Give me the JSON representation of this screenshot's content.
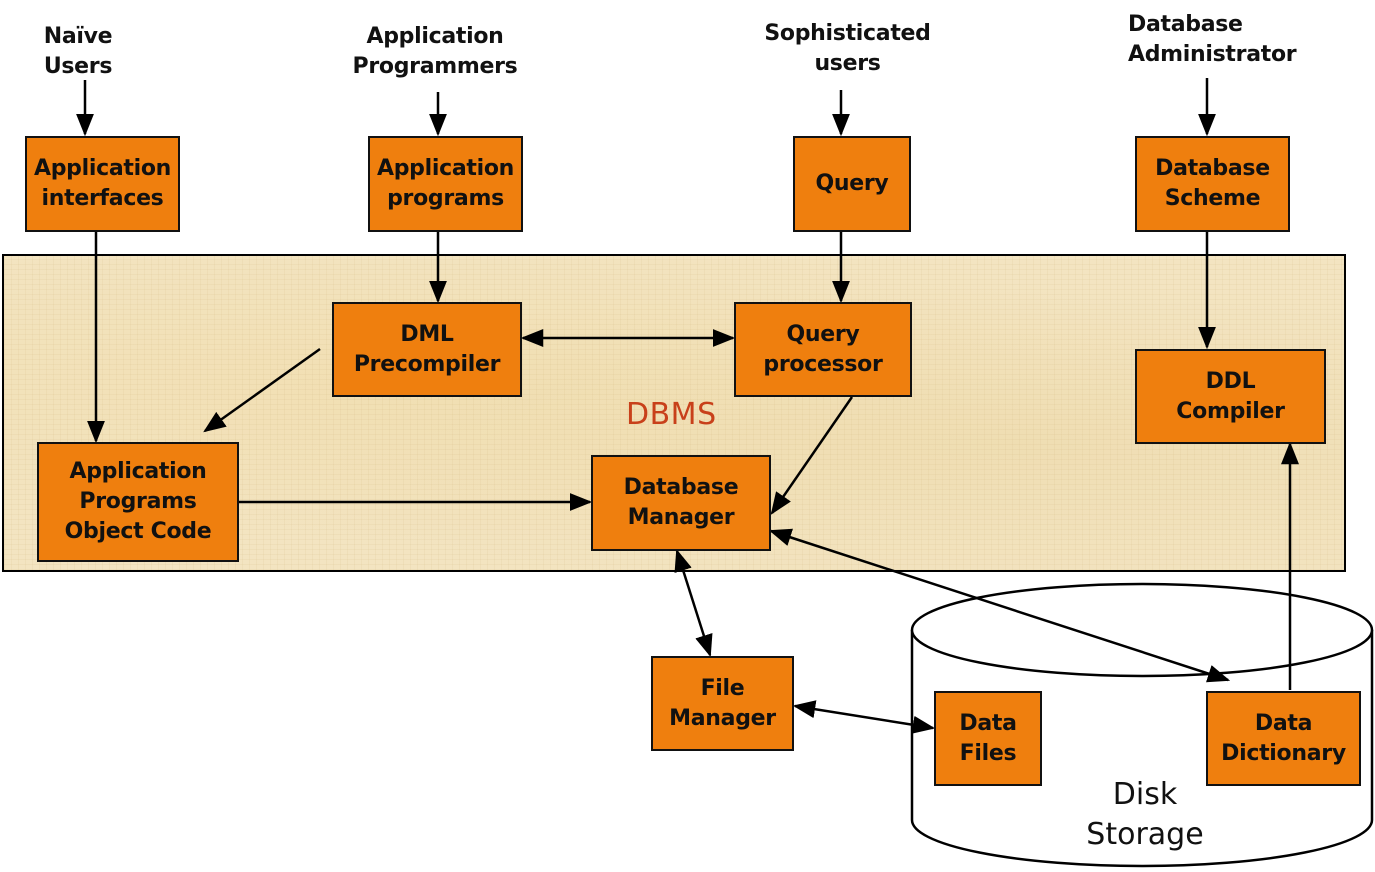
{
  "diagram": {
    "container_label": "DBMS",
    "actors": {
      "naive_users": "Naïve\nUsers",
      "application_programmers": "Application\nProgrammers",
      "sophisticated_users": "Sophisticated\nusers",
      "database_administrator": "Database\nAdministrator"
    },
    "boxes": {
      "application_interfaces": "Application\ninterfaces",
      "application_programs": "Application\nprograms",
      "query": "Query",
      "database_scheme": "Database\nScheme",
      "dml_precompiler": "DML\nPrecompiler",
      "query_processor": "Query\nprocessor",
      "ddl_compiler": "DDL\nCompiler",
      "application_programs_object_code": "Application\nPrograms\nObject Code",
      "database_manager": "Database\nManager",
      "file_manager": "File\nManager",
      "data_files": "Data\nFiles",
      "data_dictionary": "Data\nDictionary"
    },
    "storage_label": "Disk\nStorage",
    "edges": [
      {
        "from": "Naïve Users",
        "to": "Application interfaces",
        "direction": "forward"
      },
      {
        "from": "Application Programmers",
        "to": "Application programs",
        "direction": "forward"
      },
      {
        "from": "Sophisticated users",
        "to": "Query",
        "direction": "forward"
      },
      {
        "from": "Database Administrator",
        "to": "Database Scheme",
        "direction": "forward"
      },
      {
        "from": "Application interfaces",
        "to": "Application Programs Object Code",
        "direction": "forward"
      },
      {
        "from": "Application programs",
        "to": "DML Precompiler",
        "direction": "forward"
      },
      {
        "from": "Query",
        "to": "Query processor",
        "direction": "forward"
      },
      {
        "from": "Database Scheme",
        "to": "DDL Compiler",
        "direction": "forward"
      },
      {
        "from": "DML Precompiler",
        "to": "Query processor",
        "direction": "both"
      },
      {
        "from": "DML Precompiler",
        "to": "Application Programs Object Code",
        "direction": "forward"
      },
      {
        "from": "Application Programs Object Code",
        "to": "Database Manager",
        "direction": "forward"
      },
      {
        "from": "Query processor",
        "to": "Database Manager",
        "direction": "forward"
      },
      {
        "from": "Database Manager",
        "to": "File Manager",
        "direction": "both"
      },
      {
        "from": "Database Manager",
        "to": "Data Dictionary",
        "direction": "both"
      },
      {
        "from": "File Manager",
        "to": "Data Files",
        "direction": "both"
      },
      {
        "from": "Data Dictionary",
        "to": "DDL Compiler",
        "direction": "forward"
      }
    ]
  }
}
